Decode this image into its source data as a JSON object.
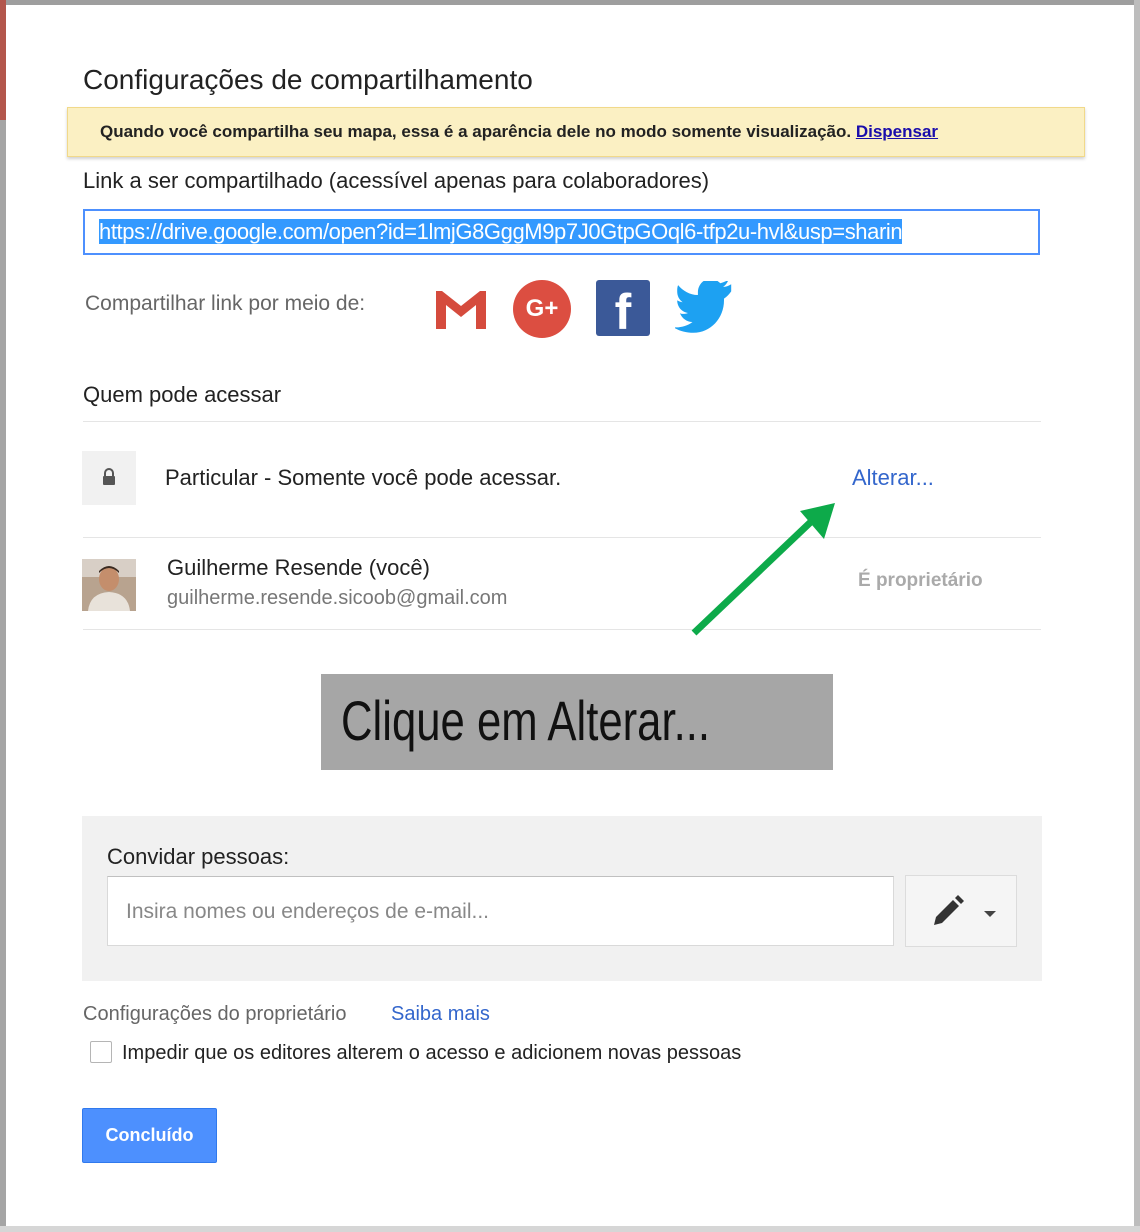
{
  "dialog": {
    "title": "Configurações de compartilhamento",
    "banner": {
      "message": "Quando você compartilha seu mapa, essa é a aparência dele no modo somente visualização.",
      "dismiss_label": "Dispensar"
    },
    "link_section": {
      "label": "Link a ser compartilhado (acessível apenas para colaboradores)",
      "url": "https://drive.google.com/open?id=1lmjG8GggM9p7J0GtpGOql6-tfp2u-hvl&usp=sharin"
    },
    "share_via": {
      "label": "Compartilhar link por meio de:",
      "icons": [
        "gmail-icon",
        "google-plus-icon",
        "facebook-icon",
        "twitter-icon"
      ],
      "gplus_glyph": "G+",
      "fb_glyph": "f"
    },
    "access": {
      "title": "Quem pode acessar",
      "visibility_text": "Particular - Somente você pode acessar.",
      "change_label": "Alterar...",
      "owner": {
        "name": "Guilherme Resende (você)",
        "email": "guilherme.resende.sicoob@gmail.com",
        "role": "É proprietário"
      }
    },
    "annotation": {
      "text": "Clique em Alterar...",
      "arrow_color": "#0daa4a",
      "box_color": "#a6a6a6"
    },
    "invite": {
      "label": "Convidar pessoas:",
      "placeholder": "Insira nomes ou endereços de e-mail..."
    },
    "owner_settings": {
      "label": "Configurações do proprietário",
      "learn_more": "Saiba mais",
      "prevent_editors_label": "Impedir que os editores alterem o acesso e adicionem novas pessoas",
      "prevent_editors_checked": false
    },
    "done_label": "Concluído",
    "colors": {
      "primary_button": "#4d90fe",
      "link": "#3366cc",
      "banner_bg": "#fbf0c3"
    }
  }
}
